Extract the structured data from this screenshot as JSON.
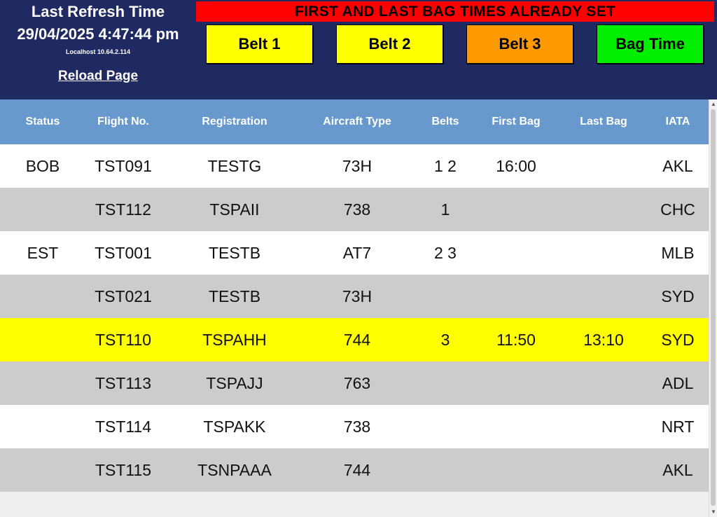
{
  "header": {
    "refresh_title": "Last Refresh Time",
    "refresh_time": "29/04/2025 4:47:44 pm",
    "host": "Localhost 10.64.2.114",
    "reload_label": "Reload Page",
    "banner": "FIRST AND LAST BAG TIMES ALREADY SET",
    "banner_color": "#ff0000",
    "buttons": [
      {
        "label": "Belt 1",
        "color": "#ffff00"
      },
      {
        "label": "Belt 2",
        "color": "#ffff00"
      },
      {
        "label": "Belt 3",
        "color": "#ff9900"
      },
      {
        "label": "Bag Time",
        "color": "#00ee00"
      }
    ]
  },
  "table": {
    "header_color": "#6799cc",
    "columns": [
      "Status",
      "Flight No.",
      "Registration",
      "Aircraft Type",
      "Belts",
      "First Bag",
      "Last Bag",
      "IATA"
    ],
    "rows": [
      {
        "bg": "#ffffff",
        "cells": [
          "BOB",
          "TST091",
          "TESTG",
          "73H",
          "1 2",
          "16:00",
          "",
          "AKL"
        ]
      },
      {
        "bg": "#cccccc",
        "cells": [
          "",
          "TST112",
          "TSPAII",
          "738",
          "1",
          "",
          "",
          "CHC"
        ]
      },
      {
        "bg": "#ffffff",
        "cells": [
          "EST",
          "TST001",
          "TESTB",
          "AT7",
          "2 3",
          "",
          "",
          "MLB"
        ]
      },
      {
        "bg": "#cccccc",
        "cells": [
          "",
          "TST021",
          "TESTB",
          "73H",
          "",
          "",
          "",
          "SYD"
        ]
      },
      {
        "bg": "#ffff00",
        "cells": [
          "",
          "TST110",
          "TSPAHH",
          "744",
          "3",
          "11:50",
          "13:10",
          "SYD"
        ]
      },
      {
        "bg": "#cccccc",
        "cells": [
          "",
          "TST113",
          "TSPAJJ",
          "763",
          "",
          "",
          "",
          "ADL"
        ]
      },
      {
        "bg": "#ffffff",
        "cells": [
          "",
          "TST114",
          "TSPAKK",
          "738",
          "",
          "",
          "",
          "NRT"
        ]
      },
      {
        "bg": "#cccccc",
        "cells": [
          "",
          "TST115",
          "TSNPAAA",
          "744",
          "",
          "",
          "",
          "AKL"
        ]
      }
    ]
  }
}
